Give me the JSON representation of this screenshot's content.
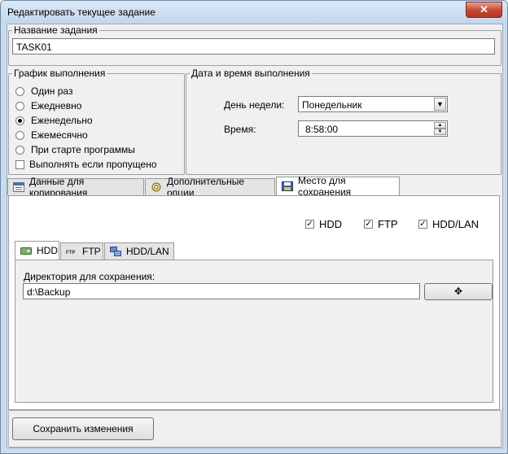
{
  "window": {
    "title": "Редактировать текущее задание",
    "close_glyph": "✕"
  },
  "task_name": {
    "label": "Название задания",
    "value": "TASK01"
  },
  "schedule": {
    "label": "График выполнения",
    "options": [
      {
        "label": "Один раз",
        "checked": false
      },
      {
        "label": "Ежедневно",
        "checked": false
      },
      {
        "label": "Еженедельно",
        "checked": true
      },
      {
        "label": "Ежемесячно",
        "checked": false
      },
      {
        "label": "При старте программы",
        "checked": false
      }
    ],
    "run_if_missed": {
      "label": "Выполнять если пропущено",
      "checked": false
    }
  },
  "datetime": {
    "label": "Дата и время выполнения",
    "weekday_label": "День недели:",
    "weekday_value": "Понедельник",
    "time_label": "Время:",
    "time_value": "8:58:00"
  },
  "main_tabs": [
    {
      "label": "Данные для копирования",
      "icon": "data-icon",
      "active": false
    },
    {
      "label": "Дополнительные опции",
      "icon": "options-icon",
      "active": false
    },
    {
      "label": "Место для сохранения",
      "icon": "disk-icon",
      "active": true
    }
  ],
  "destinations": [
    {
      "label": "HDD",
      "checked": true
    },
    {
      "label": "FTP",
      "checked": true
    },
    {
      "label": "HDD/LAN",
      "checked": true
    }
  ],
  "sub_tabs": [
    {
      "label": "HDD",
      "icon": "hdd-icon",
      "active": true
    },
    {
      "label": "FTP",
      "icon": "ftp-icon",
      "active": false
    },
    {
      "label": "HDD/LAN",
      "icon": "network-icon",
      "active": false
    }
  ],
  "hdd": {
    "dir_label": "Директория для сохранения:",
    "dir_value": "d:\\Backup",
    "browse_glyph": "✥"
  },
  "save_button": "Сохранить изменения",
  "colors": {
    "title_bg": "#c9dbee",
    "close_red": "#c9452e",
    "check": "#000000"
  }
}
